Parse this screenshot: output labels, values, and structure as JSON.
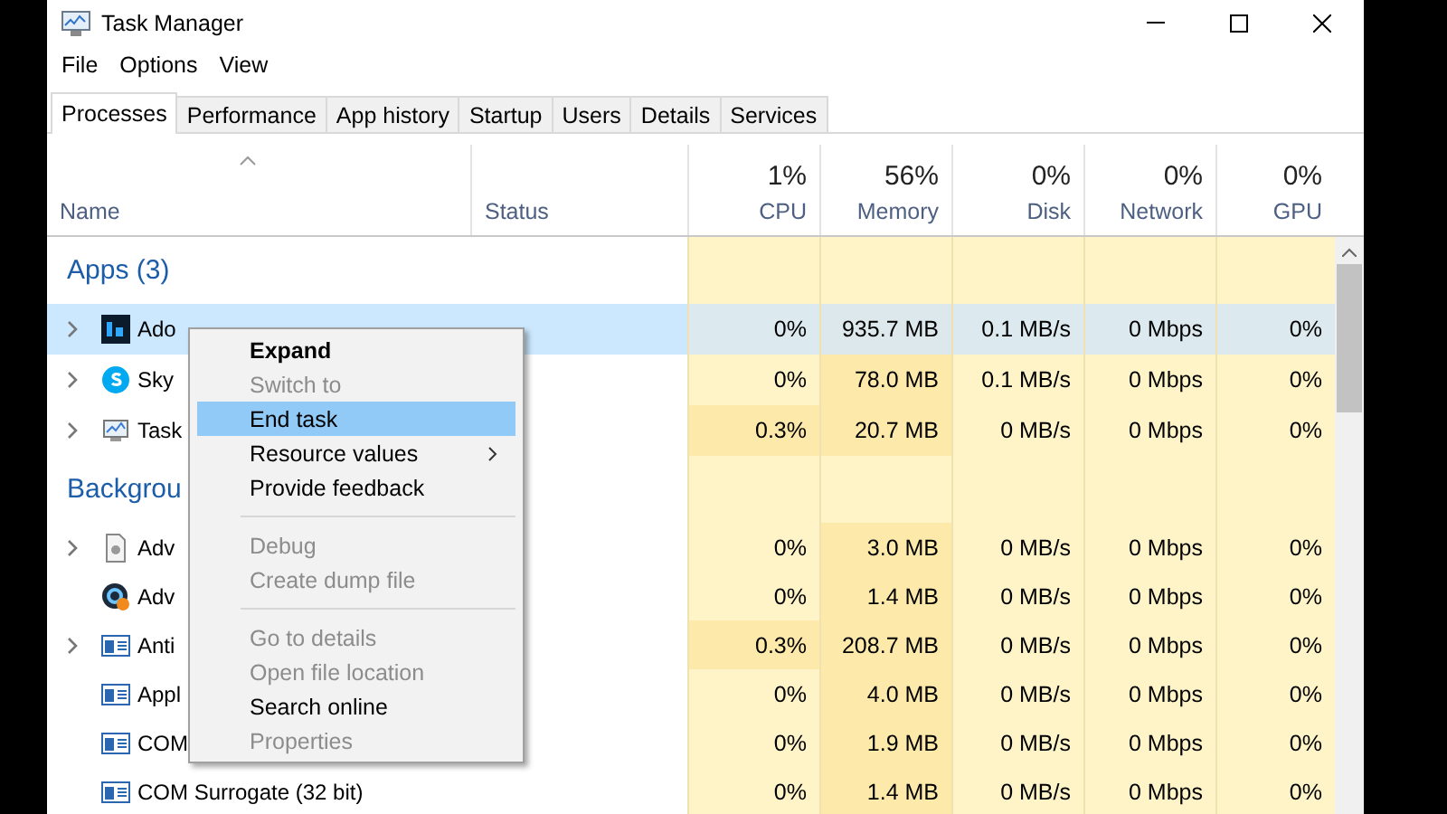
{
  "window": {
    "title": "Task Manager"
  },
  "menu_bar": [
    "File",
    "Options",
    "View"
  ],
  "tabs": [
    {
      "label": "Processes",
      "selected": true
    },
    {
      "label": "Performance",
      "selected": false
    },
    {
      "label": "App history",
      "selected": false
    },
    {
      "label": "Startup",
      "selected": false
    },
    {
      "label": "Users",
      "selected": false
    },
    {
      "label": "Details",
      "selected": false
    },
    {
      "label": "Services",
      "selected": false
    }
  ],
  "table": {
    "columns": [
      {
        "kind": "text",
        "label": "Name"
      },
      {
        "kind": "text",
        "label": "Status"
      },
      {
        "kind": "metric",
        "total": "1%",
        "label": "CPU"
      },
      {
        "kind": "metric",
        "total": "56%",
        "label": "Memory"
      },
      {
        "kind": "metric",
        "total": "0%",
        "label": "Disk"
      },
      {
        "kind": "metric",
        "total": "0%",
        "label": "Network"
      },
      {
        "kind": "metric",
        "total": "0%",
        "label": "GPU"
      }
    ],
    "rows": [
      {
        "kind": "group",
        "name": "Apps (3)"
      },
      {
        "kind": "process",
        "name": "Ado",
        "expandable": true,
        "selected": true,
        "cpu": "0%",
        "memory": "935.7 MB",
        "disk": "0.1 MB/s",
        "network": "0 Mbps",
        "gpu": "0%"
      },
      {
        "kind": "process",
        "name": "Sky",
        "expandable": true,
        "selected": false,
        "cpu": "0%",
        "memory": "78.0 MB",
        "disk": "0.1 MB/s",
        "network": "0 Mbps",
        "gpu": "0%"
      },
      {
        "kind": "process",
        "name": "Task",
        "expandable": true,
        "selected": false,
        "cpu": "0.3%",
        "memory": "20.7 MB",
        "disk": "0 MB/s",
        "network": "0 Mbps",
        "gpu": "0%"
      },
      {
        "kind": "group",
        "name": "Backgrou"
      },
      {
        "kind": "process",
        "name": "Adv",
        "expandable": true,
        "selected": false,
        "cpu": "0%",
        "memory": "3.0 MB",
        "disk": "0 MB/s",
        "network": "0 Mbps",
        "gpu": "0%"
      },
      {
        "kind": "process",
        "name": "Adv",
        "expandable": false,
        "selected": false,
        "cpu": "0%",
        "memory": "1.4 MB",
        "disk": "0 MB/s",
        "network": "0 Mbps",
        "gpu": "0%"
      },
      {
        "kind": "process",
        "name": "Anti",
        "expandable": true,
        "selected": false,
        "cpu": "0.3%",
        "memory": "208.7 MB",
        "disk": "0 MB/s",
        "network": "0 Mbps",
        "gpu": "0%"
      },
      {
        "kind": "process",
        "name": "Appl",
        "expandable": false,
        "selected": false,
        "cpu": "0%",
        "memory": "4.0 MB",
        "disk": "0 MB/s",
        "network": "0 Mbps",
        "gpu": "0%"
      },
      {
        "kind": "process",
        "name": "COM",
        "expandable": false,
        "selected": false,
        "cpu": "0%",
        "memory": "1.9 MB",
        "disk": "0 MB/s",
        "network": "0 Mbps",
        "gpu": "0%"
      },
      {
        "kind": "process",
        "name": "COM Surrogate (32 bit)",
        "expandable": false,
        "selected": false,
        "cpu": "0%",
        "memory": "1.4 MB",
        "disk": "0 MB/s",
        "network": "0 Mbps",
        "gpu": "0%"
      }
    ]
  },
  "context_menu": [
    {
      "kind": "item",
      "label": "Expand",
      "default": true,
      "disabled": false,
      "selected": false
    },
    {
      "kind": "item",
      "label": "Switch to",
      "disabled": true,
      "selected": false
    },
    {
      "kind": "item",
      "label": "End task",
      "disabled": false,
      "selected": true
    },
    {
      "kind": "item",
      "label": "Resource values",
      "disabled": false,
      "selected": false,
      "submenu": true
    },
    {
      "kind": "item",
      "label": "Provide feedback",
      "disabled": false,
      "selected": false
    },
    {
      "kind": "separator"
    },
    {
      "kind": "item",
      "label": "Debug",
      "disabled": true,
      "selected": false
    },
    {
      "kind": "item",
      "label": "Create dump file",
      "disabled": true,
      "selected": false
    },
    {
      "kind": "separator"
    },
    {
      "kind": "item",
      "label": "Go to details",
      "disabled": true,
      "selected": false
    },
    {
      "kind": "item",
      "label": "Open file location",
      "disabled": true,
      "selected": false
    },
    {
      "kind": "item",
      "label": "Search online",
      "disabled": false,
      "selected": false
    },
    {
      "kind": "item",
      "label": "Properties",
      "disabled": true,
      "selected": false
    }
  ]
}
